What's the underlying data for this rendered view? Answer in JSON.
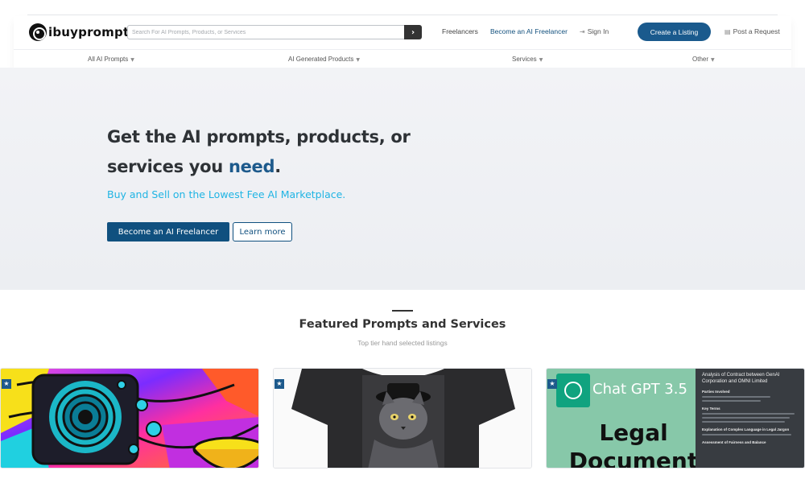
{
  "header": {
    "logo_text": "ibuyprompts",
    "search": {
      "placeholder": "Search For AI Prompts, Products, or Services",
      "button_glyph": "›"
    },
    "links": {
      "freelancers": "Freelancers",
      "become": "Become an AI Freelancer",
      "signin": "Sign In",
      "create": "Create a Listing",
      "post": "Post a Request"
    },
    "subnav": [
      "All AI Prompts",
      "AI Generated Products",
      "Services",
      "Other"
    ]
  },
  "hero": {
    "title_line1": "Get the AI prompts, products, or",
    "title_line2_pre": "services you ",
    "title_line2_accent": "need",
    "title_line2_post": ".",
    "subtitle": "Buy and Sell on the Lowest Fee AI Marketplace.",
    "primary_button": "Become an AI Freelancer",
    "secondary_button": "Learn more"
  },
  "featured": {
    "title": "Featured Prompts and Services",
    "subtitle": "Top tier hand selected listings",
    "cards": [
      {
        "badge": "★",
        "image": "psychedelic-abstract-art"
      },
      {
        "badge": "★",
        "image": "cat-tshirt"
      },
      {
        "badge": "★",
        "image": "chatgpt-legal-document",
        "heading": "Chat GPT 3.5",
        "big_text": "Legal Document",
        "doc_title": "Analysis of Contract between GenAI Corporation and OMNI Limited",
        "doc_sections": [
          "Parties Involved",
          "Key Terms",
          "Explanation of Complex Language in Legal Jargon",
          "Assessment of Fairness and Balance"
        ]
      }
    ]
  },
  "colors": {
    "brand": "#1a5a8d",
    "accent_text": "#1fb4e4",
    "hero_bg": "#eef0f3"
  },
  "icons": {
    "signin": "sign-in-icon",
    "post": "document-icon",
    "chevron": "chevron-down-icon",
    "badge": "star-icon"
  }
}
